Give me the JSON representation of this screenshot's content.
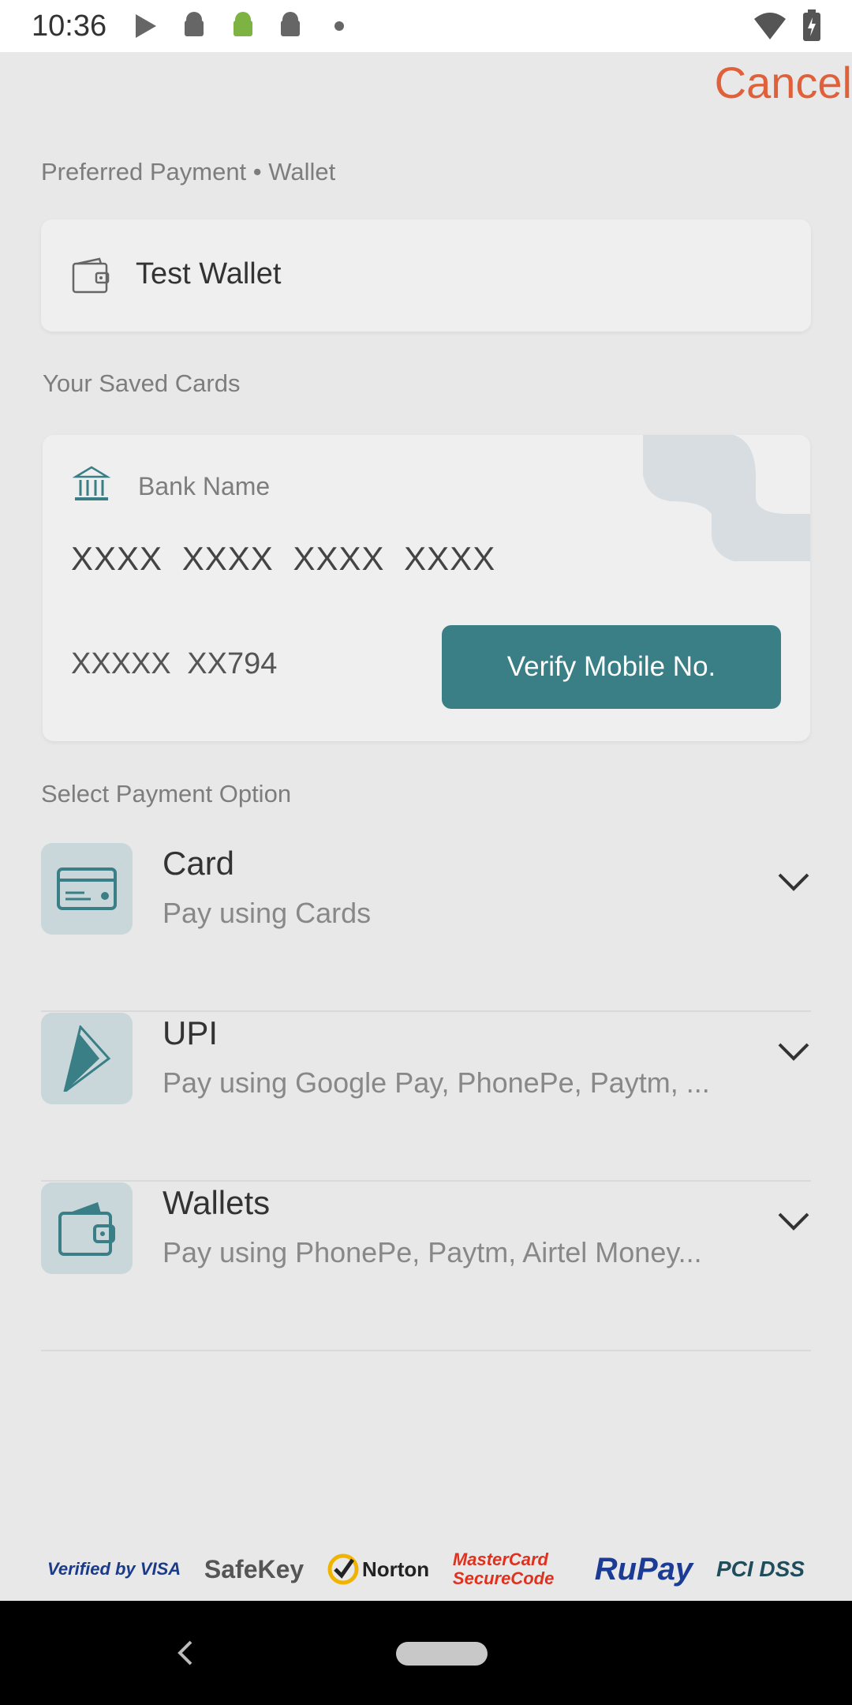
{
  "status_bar": {
    "time": "10:36"
  },
  "header": {
    "cancel_label": "Cancel"
  },
  "preferred": {
    "section_label": "Preferred Payment • Wallet",
    "wallet_name": "Test Wallet"
  },
  "saved_cards": {
    "section_label": "Your Saved Cards",
    "bank_name": "Bank Name",
    "card_number": "XXXX XXXX XXXX XXXX",
    "card_masked": "XXXXX XX794",
    "verify_label": "Verify Mobile No."
  },
  "payment_options": {
    "section_label": "Select Payment Option",
    "items": [
      {
        "title": "Card",
        "subtitle": "Pay using Cards",
        "icon": "credit-card-icon"
      },
      {
        "title": "UPI",
        "subtitle": "Pay using Google Pay, PhonePe, Paytm, ...",
        "icon": "upi-icon"
      },
      {
        "title": "Wallets",
        "subtitle": "Pay using PhonePe, Paytm, Airtel Money...",
        "icon": "wallet-icon"
      }
    ]
  },
  "trust_logos": [
    "Verified by VISA",
    "SafeKey",
    "Norton",
    "MasterCard SecureCode",
    "RuPay",
    "PCI DSS"
  ],
  "colors": {
    "accent": "#3a7f86",
    "cancel": "#e0603a",
    "background": "#e8e8e8"
  }
}
